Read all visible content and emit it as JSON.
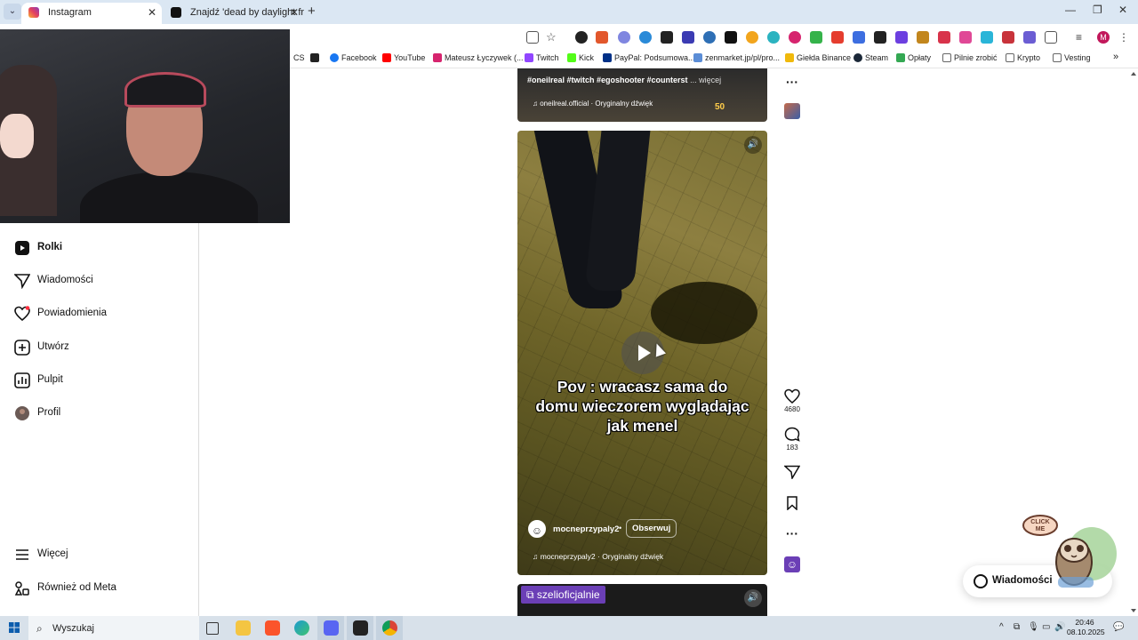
{
  "browser": {
    "tabs": [
      {
        "title": "Instagram",
        "active": true
      },
      {
        "title": "Znajdź 'dead by daylight from '",
        "active": false
      }
    ],
    "bookmarks": [
      "CS",
      "Facebook",
      "YouTube",
      "Mateusz Łyczywek (...",
      "Twitch",
      "Kick",
      "PayPal: Podsumowa...",
      "zenmarket.jp/pl/pro...",
      "Giełda Binance",
      "Steam",
      "Opłaty",
      "Pilnie zrobić",
      "Krypto",
      "Vesting"
    ],
    "bookmarks_more": "»",
    "profile_initial": "M"
  },
  "sidebar": {
    "items": [
      {
        "label": "Rolki",
        "icon": "reels-icon"
      },
      {
        "label": "Wiadomości",
        "icon": "send-icon"
      },
      {
        "label": "Powiadomienia",
        "icon": "heart-icon"
      },
      {
        "label": "Utwórz",
        "icon": "plus-square-icon"
      },
      {
        "label": "Pulpit",
        "icon": "dashboard-icon"
      },
      {
        "label": "Profil",
        "icon": "avatar-icon"
      }
    ],
    "bottom": [
      {
        "label": "Więcej",
        "icon": "menu-icon"
      },
      {
        "label": "Również od Meta",
        "icon": "meta-icon"
      }
    ]
  },
  "feed": {
    "prev_post": {
      "caption_tags": "#oneilreal #twitch #egoshooter #counterst",
      "caption_more": "... więcej",
      "audio": "oneilreal.official · Oryginalny dźwięk",
      "badge": "50"
    },
    "reel": {
      "overlay_text": "Pov : wracasz sama do domu wieczorem wyglądając jak menel",
      "username": "mocneprzypaly2",
      "follow_label": "Obserwuj",
      "audio": "mocneprzypaly2 · Oryginalny dźwięk",
      "likes": "4680",
      "comments": "183"
    },
    "next_post": {
      "tag": "szelioficjalnie"
    }
  },
  "messages_widget": {
    "label": "Wiadomości"
  },
  "taskbar": {
    "search_placeholder": "Wyszukaj",
    "time": "20:46",
    "date": "08.10.2025"
  }
}
